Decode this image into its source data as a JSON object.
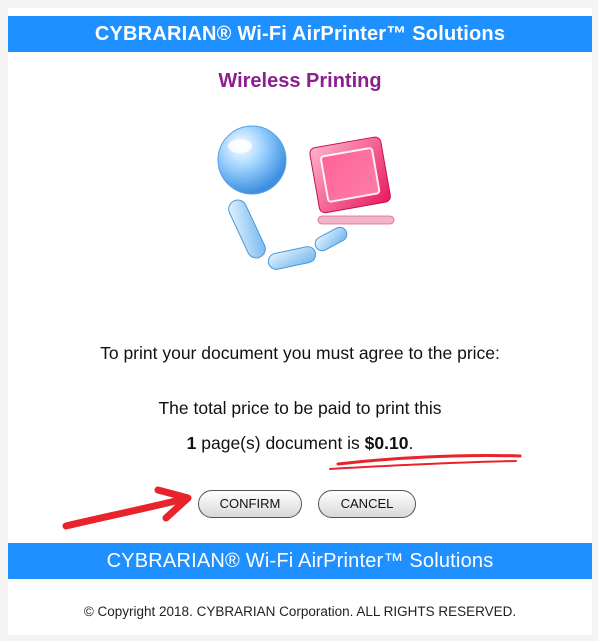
{
  "header": {
    "banner_text": "CYBRARIAN® Wi-Fi AirPrinter™ Solutions"
  },
  "main": {
    "title": "Wireless Printing",
    "logo_icon": "wireless-printing-logo-icon",
    "agree_text": "To print your document you must agree to the price:",
    "price_line1": "The total price to be paid to print this",
    "pages_count": "1",
    "price_line2_mid": " page(s) document is ",
    "price_value": "$0.10",
    "price_suffix": "."
  },
  "buttons": {
    "confirm_label": "CONFIRM",
    "cancel_label": "CANCEL"
  },
  "footer": {
    "banner_text": "CYBRARIAN® Wi-Fi AirPrinter™ Solutions",
    "copyright": "© Copyright 2018. CYBRARIAN Corporation. ALL RIGHTS RESERVED."
  },
  "colors": {
    "banner": "#1e90ff",
    "title": "#8b1f8f",
    "annotation": "#e8232b"
  }
}
